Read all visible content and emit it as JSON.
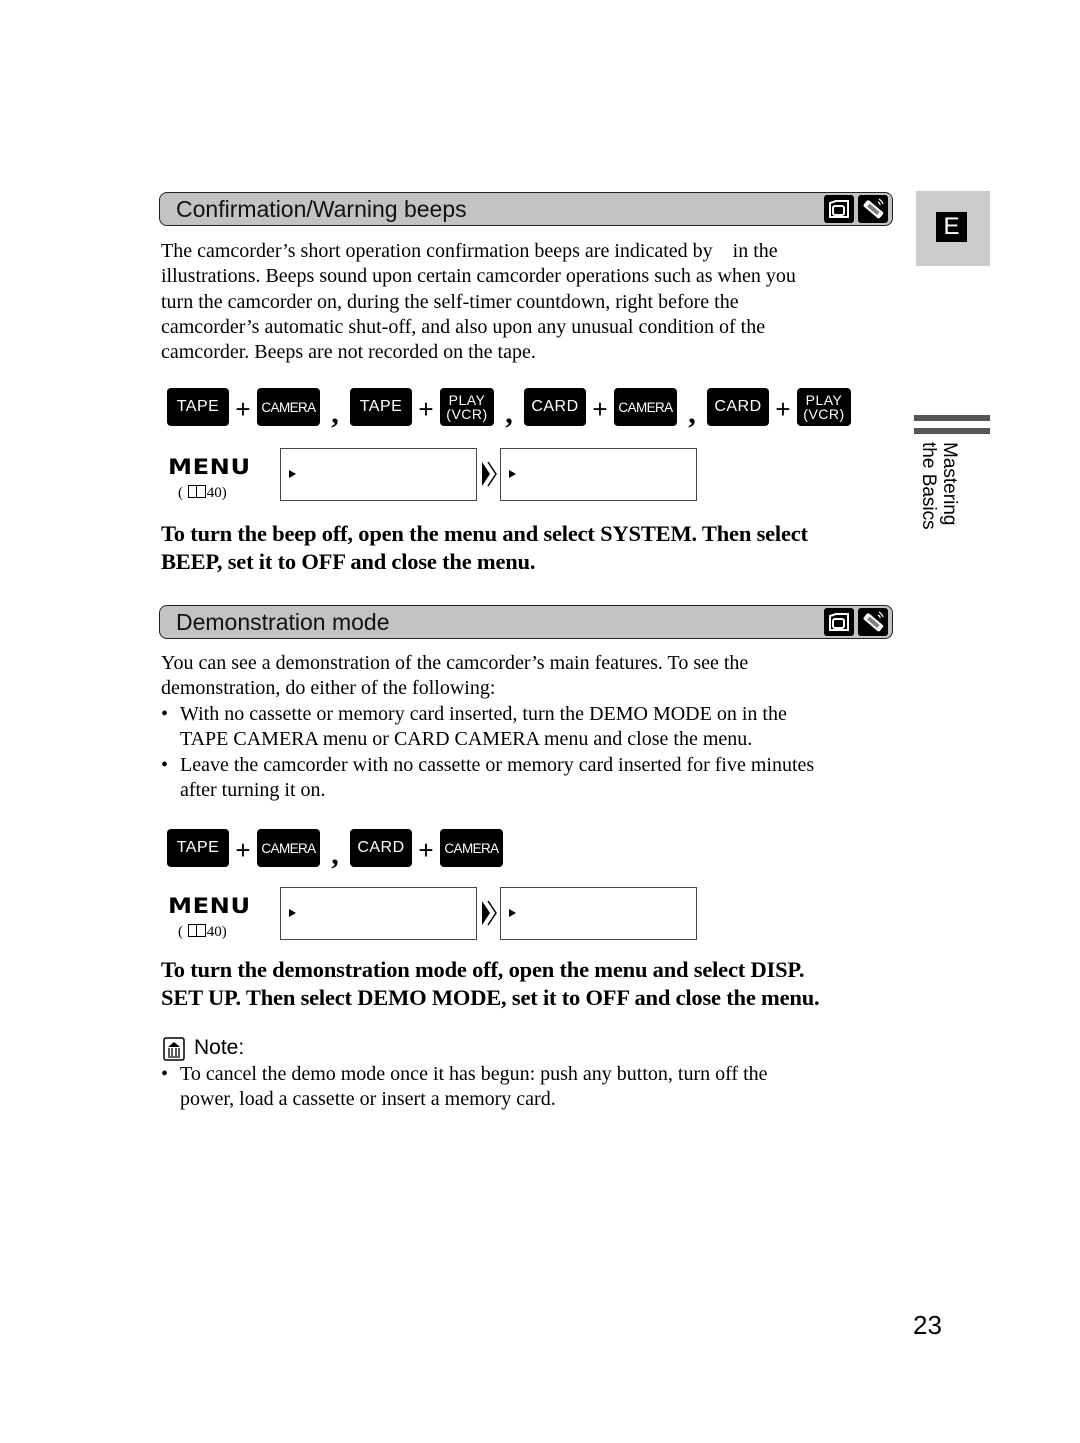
{
  "side_tab": {
    "language_letter": "E",
    "chapter_line1": "Mastering",
    "chapter_line2": "the Basics"
  },
  "page_number": "23",
  "section1": {
    "title": "Confirmation/Warning beeps",
    "mode_icons": [
      "camcorder-icon",
      "remote-control-icon"
    ],
    "paragraph_lines": [
      "The camcorder’s short operation confirmation beeps are indicated by    in the",
      "illustrations. Beeps sound upon certain camcorder operations such as when you",
      "turn the camcorder on, during the self-timer countdown, right before the",
      "camcorder’s automatic shut-off, and also upon any unusual condition of the",
      "camcorder. Beeps are not recorded on the tape."
    ],
    "mode_keys": {
      "tape": "TAPE",
      "camera": "CAMERA",
      "card": "CARD",
      "play_line1": "PLAY",
      "play_line2": "(VCR)",
      "plus": "+",
      "comma": ","
    },
    "menu_label": "MENU",
    "menu_ref": {
      "open": "(",
      "page": "40)"
    },
    "instruction_lines": [
      "To turn the beep off, open the menu and select SYSTEM. Then select",
      "BEEP, set it to OFF and close the menu."
    ]
  },
  "section2": {
    "title": "Demonstration mode",
    "mode_icons": [
      "camcorder-icon",
      "remote-control-icon"
    ],
    "paragraph_lines": [
      "You can see a demonstration of the camcorder’s main features. To see the",
      "demonstration, do either of the following:"
    ],
    "bullets": [
      {
        "line1": "With no cassette or memory card inserted, turn the DEMO MODE on in the",
        "line2": "TAPE CAMERA menu or CARD CAMERA menu and close the menu."
      },
      {
        "line1": "Leave the camcorder with no cassette or memory card inserted for five minutes",
        "line2": "after turning it on."
      }
    ],
    "bullet_char": "•",
    "menu_label": "MENU",
    "menu_ref": {
      "open": "(",
      "page": "40)"
    },
    "instruction_lines": [
      "To turn the demonstration mode off, open the menu and select DISP.",
      "SET UP. Then select DEMO MODE, set it to OFF and close the menu."
    ]
  },
  "note": {
    "label": "Note:",
    "bullets": [
      {
        "line1": "To cancel the demo mode once it has begun: push any button, turn off the",
        "line2": "power, load a cassette or insert a memory card."
      }
    ]
  },
  "colors": {
    "header_bg": "#c3c3c3",
    "side_tab_bg": "#cccccc",
    "chapter_bar": "#555555"
  }
}
